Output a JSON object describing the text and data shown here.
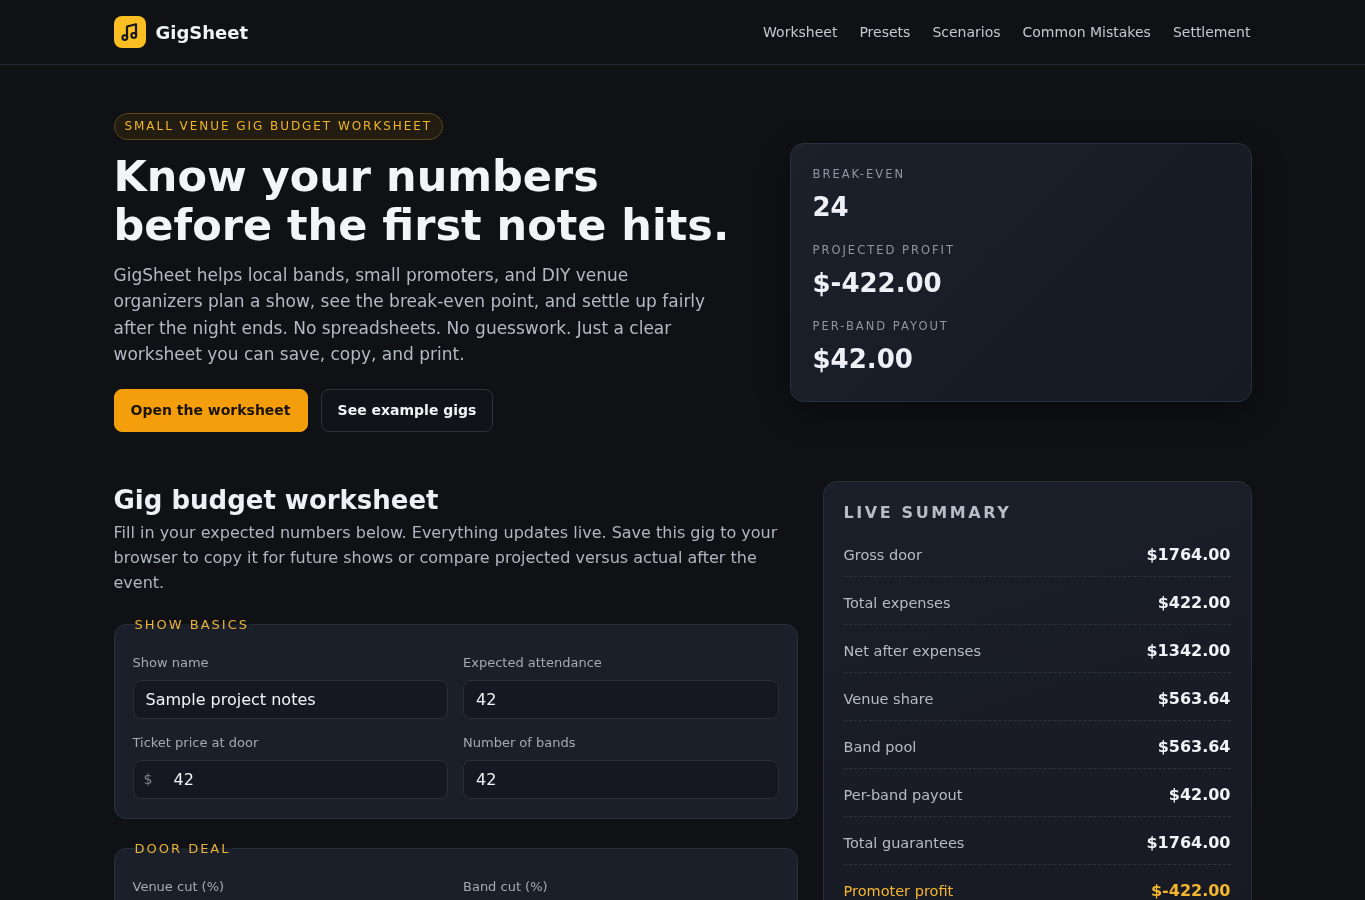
{
  "header": {
    "brand": "GigSheet",
    "nav": [
      {
        "label": "Worksheet"
      },
      {
        "label": "Presets"
      },
      {
        "label": "Scenarios"
      },
      {
        "label": "Common Mistakes"
      },
      {
        "label": "Settlement"
      }
    ]
  },
  "hero": {
    "badge": "SMALL VENUE GIG BUDGET WORKSHEET",
    "headline": "Know your numbers before the first note hits.",
    "intro": "GigSheet helps local bands, small promoters, and DIY venue organizers plan a show, see the break-even point, and settle up fairly after the night ends. No spreadsheets. No guesswork. Just a clear worksheet you can save, copy, and print.",
    "buttons": [
      {
        "label": "Open the worksheet",
        "kind": "primary"
      },
      {
        "label": "See example gigs",
        "kind": "secondary"
      }
    ],
    "stats": [
      {
        "label": "BREAK-EVEN",
        "value": "24"
      },
      {
        "label": "PROJECTED PROFIT",
        "value": "$-422.00"
      },
      {
        "label": "PER-BAND PAYOUT",
        "value": "$42.00"
      }
    ]
  },
  "worksheet": {
    "title": "Gig budget worksheet",
    "intro": "Fill in your expected numbers below. Everything updates live. Save this gig to your browser to copy it for future shows or compare projected versus actual after the event.",
    "sections": [
      {
        "legend": "SHOW BASICS",
        "fields": [
          {
            "label": "Show name",
            "value": "Sample project notes"
          },
          {
            "label": "Expected attendance",
            "value": "42"
          },
          {
            "label": "Ticket price at door",
            "prefix": "$",
            "value": "42"
          },
          {
            "label": "Number of bands",
            "value": "42"
          }
        ]
      },
      {
        "legend": "DOOR DEAL",
        "fields": [
          {
            "label": "Venue cut (%)"
          },
          {
            "label": "Band cut (%)"
          }
        ]
      }
    ]
  },
  "summary": {
    "title": "LIVE SUMMARY",
    "rows": [
      {
        "label": "Gross door",
        "value": "$1764.00",
        "highlight": false
      },
      {
        "label": "Total expenses",
        "value": "$422.00",
        "highlight": false
      },
      {
        "label": "Net after expenses",
        "value": "$1342.00",
        "highlight": false
      },
      {
        "label": "Venue share",
        "value": "$563.64",
        "highlight": false
      },
      {
        "label": "Band pool",
        "value": "$563.64",
        "highlight": false
      },
      {
        "label": "Per-band payout",
        "value": "$42.00",
        "highlight": false
      },
      {
        "label": "Total guarantees",
        "value": "$1764.00",
        "highlight": false
      },
      {
        "label": "Promoter profit",
        "value": "$-422.00",
        "highlight": true
      }
    ]
  }
}
